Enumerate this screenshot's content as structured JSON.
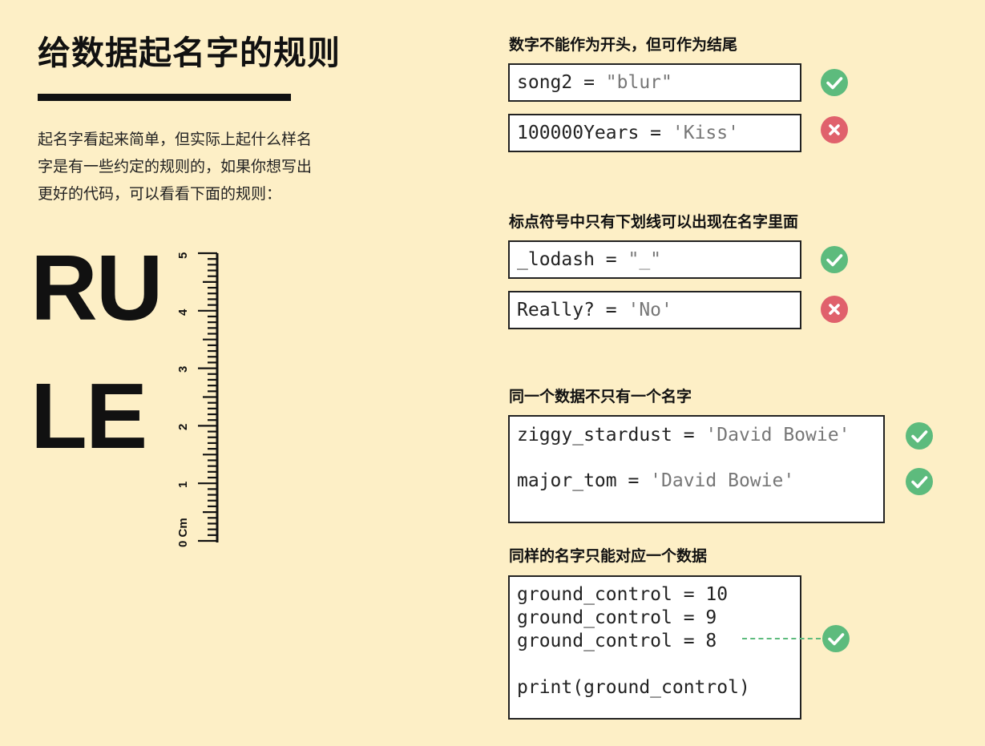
{
  "title": "给数据起名字的规则",
  "intro": {
    "lines": [
      "起名字看起来简单，但实际上起什么样名",
      "字是有一些约定的规则的，如果你想写出",
      "更好的代码，可以看看下面的规则："
    ]
  },
  "big_word": {
    "line1": "RU",
    "line2": "LE"
  },
  "ruler": {
    "labels": [
      "0 Cm",
      "1",
      "2",
      "3",
      "4",
      "5"
    ]
  },
  "rules": [
    {
      "title": "数字不能作为开头，但可作为结尾",
      "examples": [
        {
          "code": "song2 = ",
          "value": "\"blur\"",
          "status": "valid",
          "icon": "check-icon"
        },
        {
          "code": "100000Years = ",
          "value": "'Kiss'",
          "status": "invalid",
          "icon": "cross-icon"
        }
      ]
    },
    {
      "title": "标点符号中只有下划线可以出现在名字里面",
      "examples": [
        {
          "code": "_lodash = ",
          "value": "\"_\"",
          "status": "valid",
          "icon": "check-icon"
        },
        {
          "code": "Really? = ",
          "value": "'No'",
          "status": "invalid",
          "icon": "cross-icon"
        }
      ]
    },
    {
      "title": "同一个数据不只有一个名字",
      "examples": [
        {
          "code": "ziggy_stardust = ",
          "value": "'David Bowie'",
          "status": "valid",
          "icon": "check-icon"
        },
        {
          "code": "major_tom = ",
          "value": "'David Bowie'",
          "status": "valid",
          "icon": "check-icon"
        }
      ]
    },
    {
      "title": "同样的名字只能对应一个数据",
      "code_lines": [
        "ground_control = 10",
        "ground_control = 9",
        "ground_control = 8",
        "",
        "print(ground_control)"
      ],
      "status": "valid",
      "icon": "check-icon"
    }
  ],
  "colors": {
    "background": "#fdefc6",
    "valid": "#5dbb7d",
    "invalid": "#e0616c",
    "string": "#777777"
  }
}
